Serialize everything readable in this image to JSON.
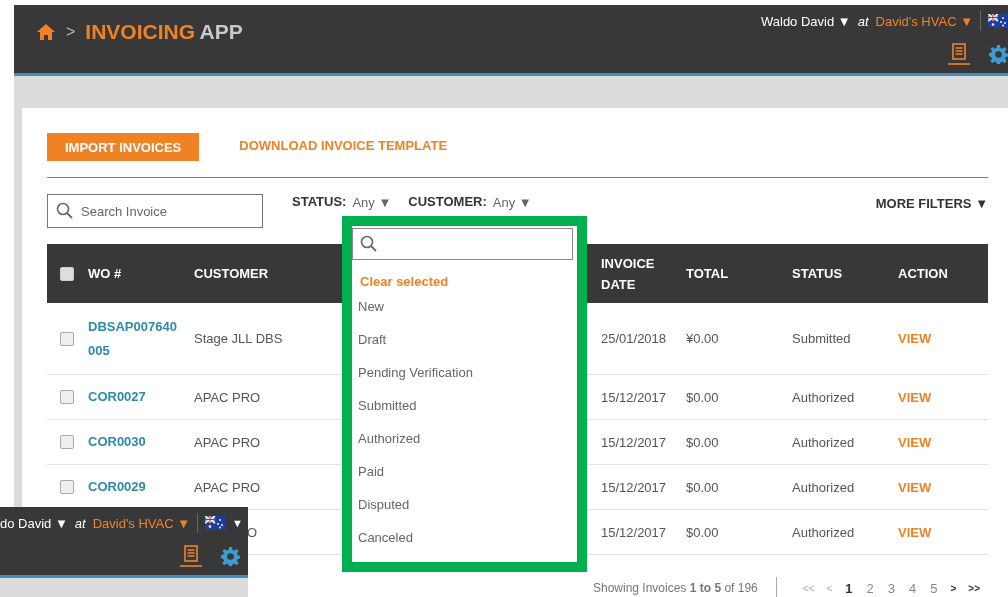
{
  "header": {
    "crumb_sep": ">",
    "brand_main": "INVOICING",
    "brand_sub": "APP",
    "user": "Waldo David ▼",
    "at": "at",
    "company": "David's HVAC ▼"
  },
  "actions": {
    "import_button": "IMPORT INVOICES",
    "template_link": "DOWNLOAD INVOICE TEMPLATE"
  },
  "filters": {
    "search": {
      "placeholder": "Search Invoice"
    },
    "status_label": "STATUS:",
    "status_value": "Any ▼",
    "customer_label": "CUSTOMER:",
    "customer_value": "Any ▼",
    "more": "MORE FILTERS ▼"
  },
  "table": {
    "select_all_checked": false,
    "columns": [
      {
        "label": "WO #"
      },
      {
        "label": "CUSTOMER"
      },
      {
        "label": "INVOICE DATE"
      },
      {
        "label": "TOTAL"
      },
      {
        "label": "STATUS"
      },
      {
        "label": "ACTION"
      }
    ],
    "rows": [
      {
        "kind": "full",
        "checked": false,
        "wo": "DBSAP007640005",
        "customer": "Stage JLL DBS",
        "invoice_date": "25/01/2018",
        "total": "¥0.00",
        "status": "Submitted",
        "action": "VIEW"
      },
      {
        "kind": "full",
        "checked": false,
        "wo": "COR0027",
        "customer": "APAC PRO",
        "invoice_date": "15/12/2017",
        "total": "$0.00",
        "status": "Authorized",
        "action": "VIEW"
      },
      {
        "kind": "full",
        "checked": false,
        "wo": "COR0030",
        "customer": "APAC PRO",
        "invoice_date": "15/12/2017",
        "total": "$0.00",
        "status": "Authorized",
        "action": "VIEW"
      },
      {
        "kind": "full",
        "checked": false,
        "wo": "COR0029",
        "customer": "APAC PRO",
        "invoice_date": "15/12/2017",
        "total": "$0.00",
        "status": "Authorized",
        "action": "VIEW"
      },
      {
        "kind": "partial",
        "customer": "O",
        "invoice_date": "15/12/2017",
        "total": "$0.00",
        "status": "Authorized",
        "action": "VIEW"
      }
    ]
  },
  "pagination": {
    "summary": "Showing Invoices **1 to 5** of 196",
    "first": "<<",
    "prev": "<",
    "pages": [
      {
        "label": "1",
        "selected": true
      },
      {
        "label": "2",
        "selected": false
      },
      {
        "label": "3",
        "selected": false
      },
      {
        "label": "4",
        "selected": false
      },
      {
        "label": "5",
        "selected": false
      }
    ],
    "next": ">",
    "last": ">>"
  },
  "status_dropdown": {
    "clear": "Clear selected",
    "options": [
      {
        "label": "New",
        "selected": false
      },
      {
        "label": "Draft",
        "selected": false
      },
      {
        "label": "Pending Verification",
        "selected": false
      },
      {
        "label": "Submitted",
        "selected": false
      },
      {
        "label": "Authorized",
        "selected": false
      },
      {
        "label": "Paid",
        "selected": false
      },
      {
        "label": "Disputed",
        "selected": false
      },
      {
        "label": "Canceled",
        "selected": false
      }
    ]
  },
  "header_fragment": {
    "user": "do David ▼",
    "at": "at",
    "company": "David's HVAC ▼",
    "flag_caret": "▼"
  }
}
